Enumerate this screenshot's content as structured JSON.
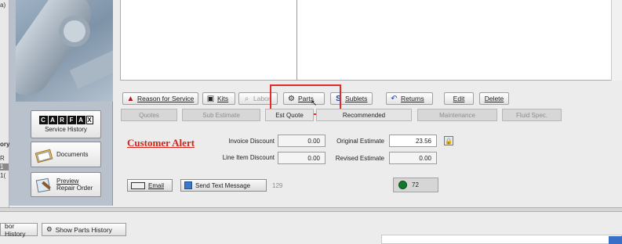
{
  "left_fragments": {
    "top": "a)",
    "history_label": "ory",
    "row1": "R",
    "row2": "1",
    "row3": "1("
  },
  "sidebar": {
    "carfax_letters": [
      "C",
      "A",
      "R",
      "F",
      "A",
      "X"
    ],
    "carfax_sub": "Service History",
    "documents": "Documents",
    "preview_line1": "Preview",
    "preview_line2": "Repair Order"
  },
  "toolbar": {
    "reason": "Reason for Service",
    "kits": "Kits",
    "labor": "Labor",
    "parts": "Parts",
    "sublets": "Sublets",
    "returns": "Returns",
    "edit": "Edit",
    "delete": "Delete"
  },
  "tabs": [
    "Quotes",
    "Sub Estimate",
    "Est Quote",
    "Recommended",
    "Maintenance",
    "Fluid Spec."
  ],
  "alert": {
    "label": "Customer Alert"
  },
  "summary": {
    "invoice_discount_label": "Invoice Discount",
    "invoice_discount_value": "0.00",
    "line_item_discount_label": "Line Item Discount",
    "line_item_discount_value": "0.00",
    "original_estimate_label": "Original Estimate",
    "original_estimate_value": "23.56",
    "revised_estimate_label": "Revised Estimate",
    "revised_estimate_value": "0.00"
  },
  "actions": {
    "email": "Email",
    "send_text": "Send Text Message",
    "text_count": "129",
    "status_value": "72"
  },
  "bottom": {
    "labor_history": "bor History",
    "parts_history": "Show Parts History"
  },
  "colors": {
    "alert_red": "#d2241a",
    "highlight_red": "#e32a2a",
    "status_green": "#147a2b"
  }
}
